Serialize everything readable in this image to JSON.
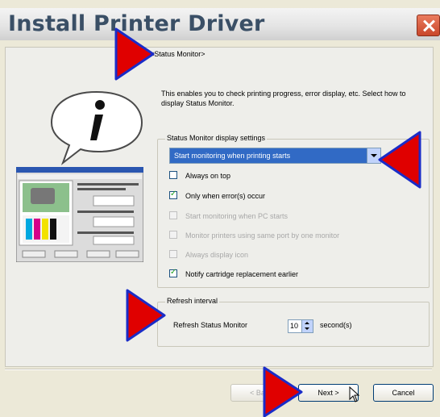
{
  "window": {
    "title": "Install Printer Driver"
  },
  "section_label": "<Status Monitor>",
  "description": "This enables you to check printing progress, error display, etc. Select how to display Status Monitor.",
  "display_settings": {
    "group_title": "Status Monitor display settings",
    "dropdown_value": "Start monitoring when printing starts",
    "options": [
      {
        "label": "Always on top",
        "checked": false,
        "enabled": true
      },
      {
        "label": "Only when error(s) occur",
        "checked": true,
        "enabled": true
      },
      {
        "label": "Start monitoring when PC starts",
        "checked": false,
        "enabled": false
      },
      {
        "label": "Monitor printers using same port by one monitor",
        "checked": false,
        "enabled": false
      },
      {
        "label": "Always display icon",
        "checked": false,
        "enabled": false
      },
      {
        "label": "Notify cartridge replacement earlier",
        "checked": true,
        "enabled": true
      }
    ]
  },
  "refresh": {
    "group_title": "Refresh interval",
    "label": "Refresh Status Monitor",
    "value": "10",
    "unit": "second(s)"
  },
  "buttons": {
    "back": "< Back",
    "next": "Next >",
    "cancel": "Cancel"
  },
  "colors": {
    "annotation_arrow": "#e00000",
    "annotation_arrow_border": "#1a2cc8",
    "selection": "#316ac5"
  }
}
